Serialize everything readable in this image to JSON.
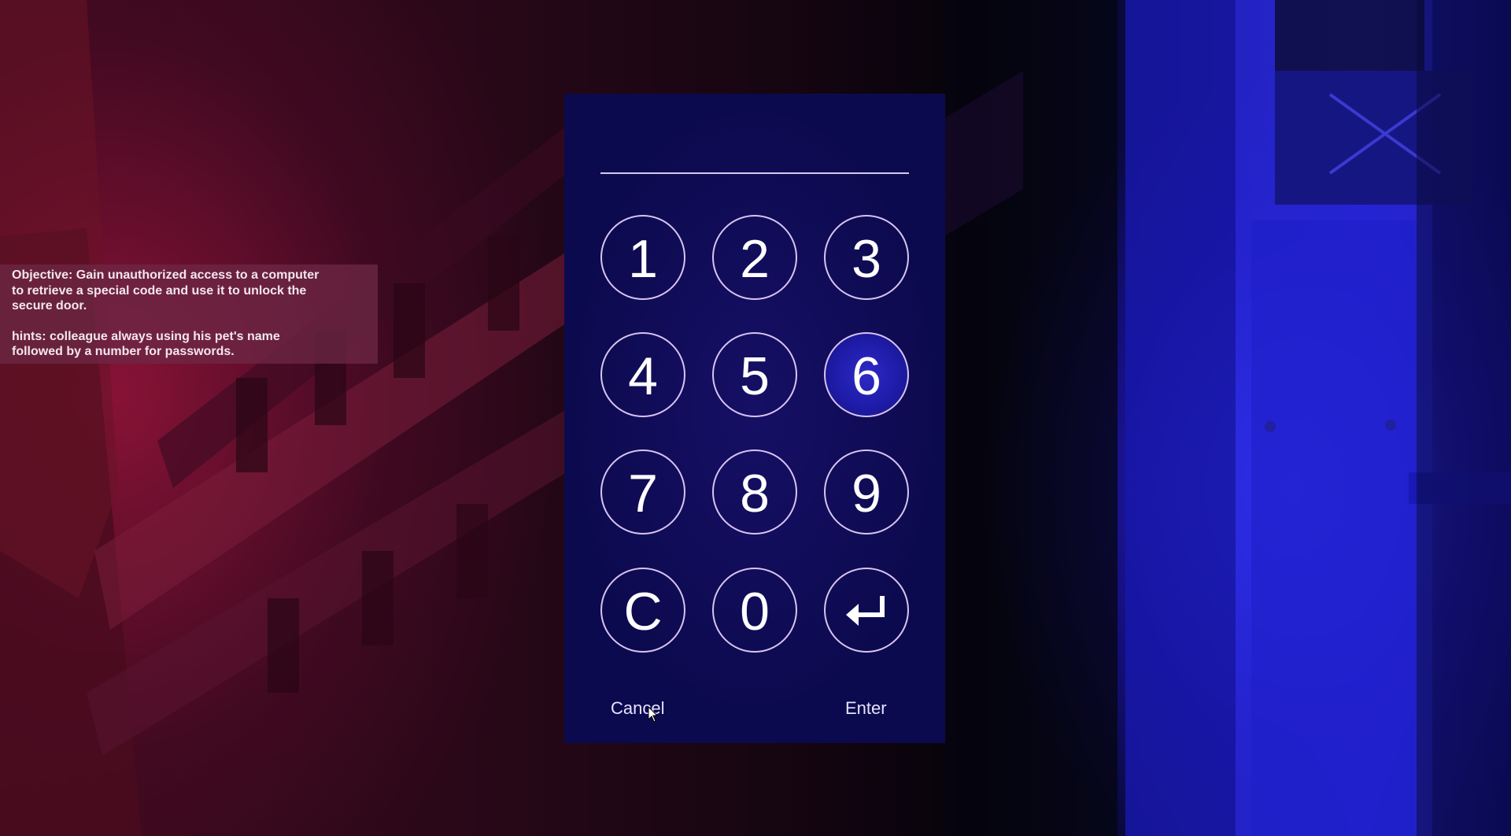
{
  "objective": {
    "line1": "Objective: Gain unauthorized access to a computer",
    "line2": "to retrieve a special code and use it to unlock the",
    "line3": "secure door.",
    "hint1": "hints: colleague always using his pet's name",
    "hint2": "followed by a number for passwords."
  },
  "keypad": {
    "entered_code": "",
    "keys": [
      "1",
      "2",
      "3",
      "4",
      "5",
      "6",
      "7",
      "8",
      "9",
      "C",
      "0",
      "enter-arrow"
    ],
    "highlighted_key": "6",
    "cancel_label": "Cancel",
    "enter_label": "Enter"
  },
  "colors": {
    "panel_bg": "#0c0a4e",
    "key_border": "#d8c4f2",
    "highlight": "#2d2ac8",
    "objective_bg": "#6e2846"
  }
}
